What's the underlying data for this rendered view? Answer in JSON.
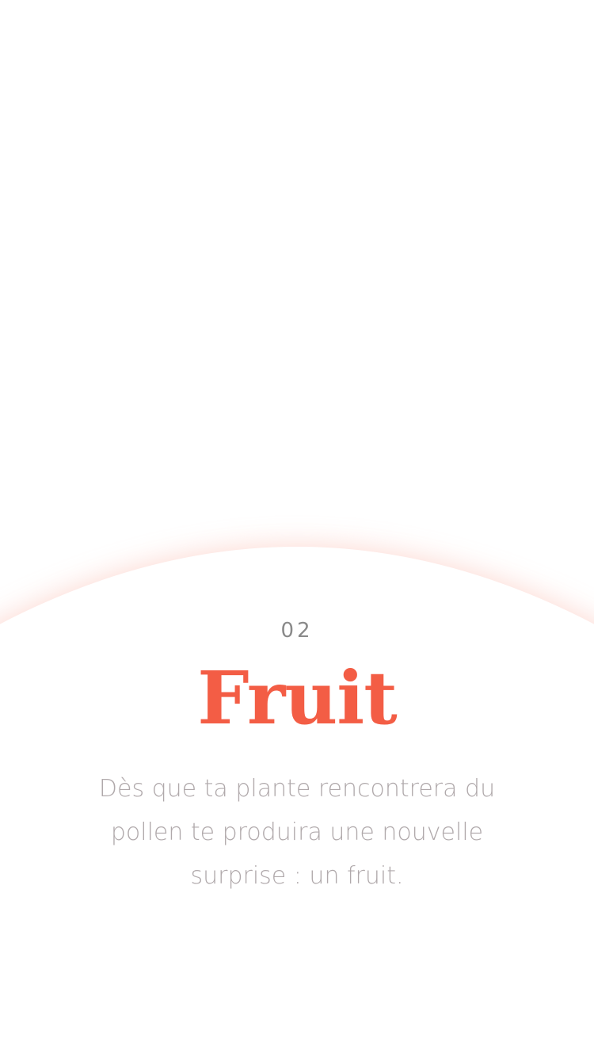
{
  "onboarding": {
    "step_number": "02",
    "title": "Fruit",
    "description": "Dès que ta plante rencontrera du pollen te produira une nouvelle surprise : un fruit."
  },
  "colors": {
    "background": "#ffffff",
    "title": "#f35d45",
    "step_number": "#8a8a8a",
    "description": "#b0a9ab",
    "arc_glow": "#fdd9d2"
  }
}
